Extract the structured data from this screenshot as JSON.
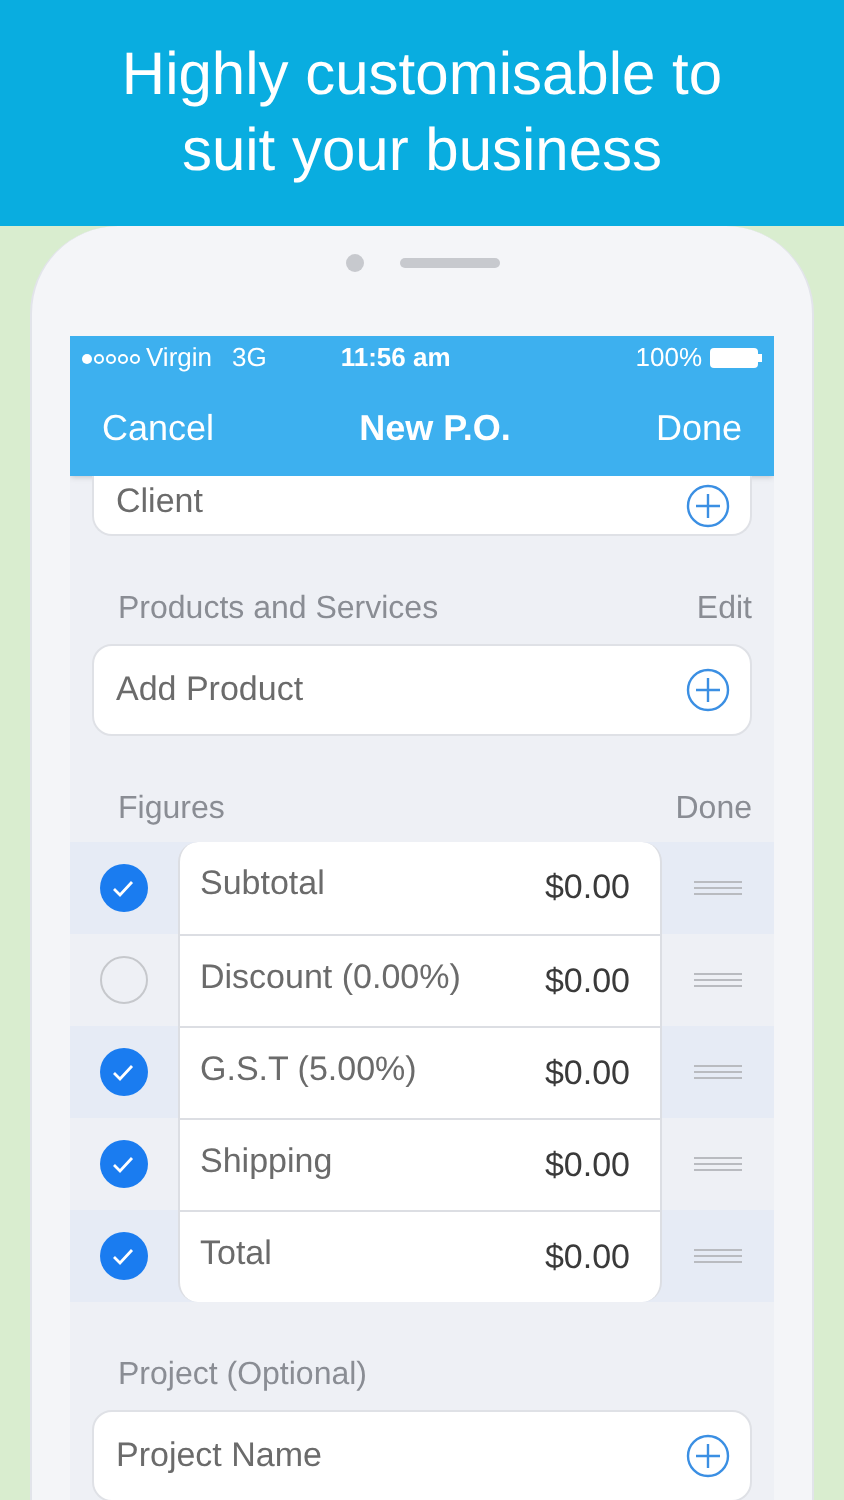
{
  "banner": {
    "headline": "Highly customisable to suit your business"
  },
  "status_bar": {
    "carrier": "Virgin",
    "network": "3G",
    "time": "11:56 am",
    "battery": "100%"
  },
  "nav_bar": {
    "left": "Cancel",
    "title": "New P.O.",
    "right": "Done"
  },
  "client": {
    "placeholder": "Client"
  },
  "products": {
    "header": "Products and Services",
    "action": "Edit",
    "placeholder": "Add Product"
  },
  "figures": {
    "header": "Figures",
    "action": "Done",
    "rows": [
      {
        "label": "Subtotal",
        "value": "$0.00",
        "checked": true
      },
      {
        "label": "Discount (0.00%)",
        "value": "$0.00",
        "checked": false
      },
      {
        "label": "G.S.T (5.00%)",
        "value": "$0.00",
        "checked": true
      },
      {
        "label": "Shipping",
        "value": "$0.00",
        "checked": true
      },
      {
        "label": "Total",
        "value": "$0.00",
        "checked": true
      }
    ]
  },
  "project": {
    "header": "Project (Optional)",
    "placeholder": "Project Name"
  }
}
